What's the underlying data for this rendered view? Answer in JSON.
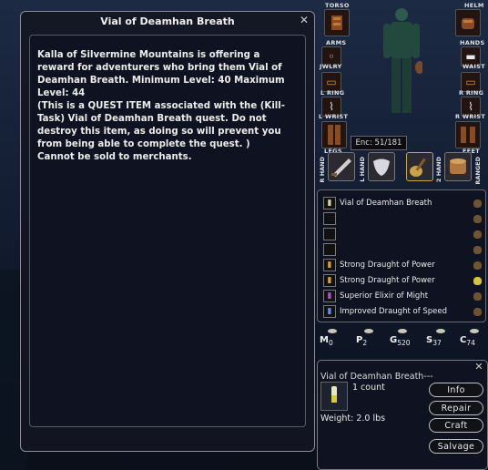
{
  "item_window": {
    "title": "Vial of Deamhan Breath",
    "close": "✕",
    "description": "Kalla of Silvermine Mountains is offering a reward for adventurers who bring them Vial of Deamhan Breath. Minimum Level: 40 Maximum Level: 44\n(This is a QUEST ITEM associated with the (Kill-Task) Vial of Deamhan Breath quest. Do not destroy this item, as doing so will prevent you from being able to complete the quest. )\nCannot be sold to merchants."
  },
  "equipment": {
    "labels": {
      "torso": "TORSO",
      "helm": "HELM",
      "arms": "ARMS",
      "hands": "HANDS",
      "jwlry": "JWLRY",
      "waist": "WAIST",
      "l_ring": "L RING",
      "r_ring": "R RING",
      "l_wrist": "L WRIST",
      "r_wrist": "R WRIST",
      "legs": "LEGS",
      "feet": "FEET",
      "r_hand": "R HAND",
      "l_hand": "L HAND",
      "two_hand": "2 HAND",
      "ranged": "RANGED"
    },
    "encumbrance": "Enc: 51/181"
  },
  "inventory": {
    "items": [
      {
        "name": "Vial of Deamhan Breath",
        "icon": "vial-icon",
        "bag": "brown"
      },
      {
        "name": "",
        "icon": "",
        "bag": "brown"
      },
      {
        "name": "",
        "icon": "",
        "bag": "brown"
      },
      {
        "name": "",
        "icon": "",
        "bag": "brown"
      },
      {
        "name": "Strong Draught of Power",
        "icon": "potion-icon",
        "bag": "brown"
      },
      {
        "name": "Strong Draught of Power",
        "icon": "potion-icon",
        "bag": "gold"
      },
      {
        "name": "Superior Elixir of Might",
        "icon": "elixir-icon",
        "bag": "brown"
      },
      {
        "name": "Improved Draught of Speed",
        "icon": "draught-icon",
        "bag": "brown"
      }
    ]
  },
  "money": {
    "mithril": {
      "label": "M",
      "value": "0"
    },
    "platinum": {
      "label": "P",
      "value": "2"
    },
    "gold": {
      "label": "G",
      "value": "520"
    },
    "silver": {
      "label": "S",
      "value": "37"
    },
    "copper": {
      "label": "C",
      "value": "74"
    }
  },
  "item_info": {
    "title": "Vial of Deamhan Breath---",
    "close": "✕",
    "count": "1 count",
    "weight": "Weight: 2.0 lbs",
    "buttons": {
      "info": "Info",
      "repair": "Repair",
      "craft": "Craft",
      "salvage": "Salvage"
    }
  },
  "colors": {
    "accent": "#c9a24a",
    "panel": "#0f1220",
    "border": "#7a7a84"
  }
}
